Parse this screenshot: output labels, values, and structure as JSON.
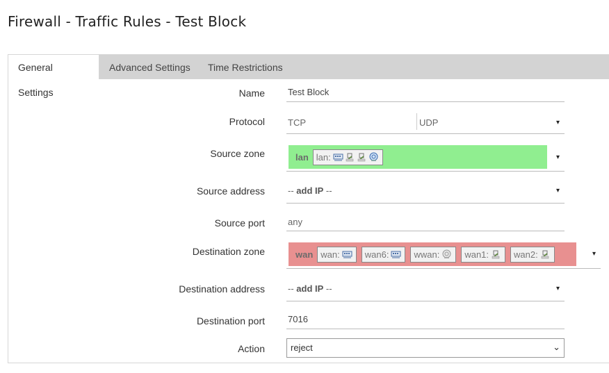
{
  "page": {
    "title": "Firewall - Traffic Rules - Test Block"
  },
  "tabs": [
    {
      "label": "General Settings",
      "active": true
    },
    {
      "label": "Advanced Settings",
      "active": false
    },
    {
      "label": "Time Restrictions",
      "active": false
    }
  ],
  "form": {
    "name": {
      "label": "Name",
      "value": "Test Block"
    },
    "protocol": {
      "label": "Protocol",
      "values": [
        "TCP",
        "UDP"
      ]
    },
    "source_zone": {
      "label": "Source zone",
      "zone": "lan",
      "color": "#90ee90",
      "networks": [
        {
          "label": "lan:",
          "icons": [
            "switch-icon",
            "ethernet-port-icon",
            "ethernet-port-icon",
            "wifi-icon"
          ]
        }
      ]
    },
    "source_address": {
      "label": "Source address",
      "prefix": "-- ",
      "value": "add IP",
      "suffix": " --"
    },
    "source_port": {
      "label": "Source port",
      "value": "any"
    },
    "destination_zone": {
      "label": "Destination zone",
      "zone": "wan",
      "color": "#e89090",
      "networks": [
        {
          "label": "wan:",
          "icons": [
            "switch-icon"
          ]
        },
        {
          "label": "wan6:",
          "icons": [
            "switch-icon"
          ]
        },
        {
          "label": "wwan:",
          "icons": [
            "wifi-disabled-icon"
          ]
        },
        {
          "label": "wan1:",
          "icons": [
            "ethernet-port-icon"
          ]
        },
        {
          "label": "wan2:",
          "icons": [
            "ethernet-port-icon"
          ]
        }
      ]
    },
    "destination_address": {
      "label": "Destination address",
      "prefix": "-- ",
      "value": "add IP",
      "suffix": " --"
    },
    "destination_port": {
      "label": "Destination port",
      "value": "7016"
    },
    "action": {
      "label": "Action",
      "value": "reject"
    }
  },
  "icons": {
    "dropdown": "▾",
    "select_chevron": "⌄"
  }
}
